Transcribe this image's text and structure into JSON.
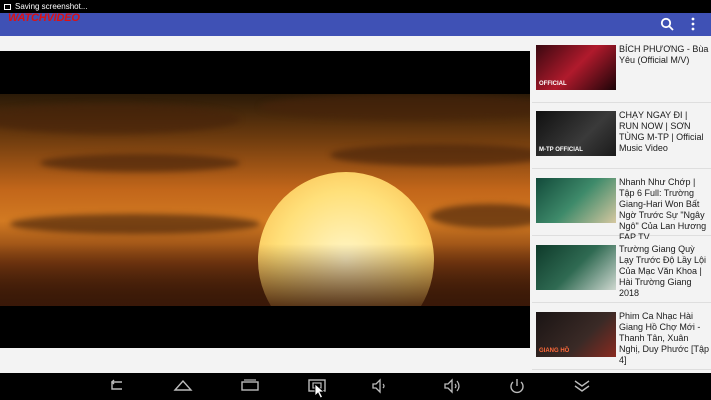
{
  "status_bar": {
    "notification_text": "Saving screenshot..."
  },
  "app_bar": {
    "logo_text": "WATCHVIDEO"
  },
  "player": {
    "scene_icon": "sunset-video-frame"
  },
  "related_videos": [
    {
      "title": "BÍCH PHƯƠNG - Bùa Yêu (Official M/V)",
      "thumb_tag": "OFFICIAL"
    },
    {
      "title": "CHẠY NGAY ĐI | RUN NOW | SƠN TÙNG M-TP | Official Music Video",
      "thumb_tag": "M-TP OFFICIAL"
    },
    {
      "title": "Nhanh Như Chớp | Tập 6 Full: Trường Giang-Hari Won Bất Ngờ Trước Sự \"Ngây Ngô\" Của Lan Hương FAP TV",
      "thumb_tag": ""
    },
    {
      "title": "Trường Giang Quỳ Lạy Trước Độ Lầy Lội Của Mạc Văn Khoa | Hài Trường Giang 2018",
      "thumb_tag": ""
    },
    {
      "title": "Phim Ca Nhạc Hài Giang Hồ Chợ Mới - Thanh Tân, Xuân Nghị, Duy Phước [Tập 4]",
      "thumb_tag": "GIANG HỒ"
    }
  ],
  "nav_bar": {
    "buttons": [
      "back-icon",
      "home-icon",
      "recents-icon",
      "screenshot-icon",
      "volume-down-icon",
      "volume-up-icon",
      "power-icon",
      "expand-icon"
    ]
  }
}
